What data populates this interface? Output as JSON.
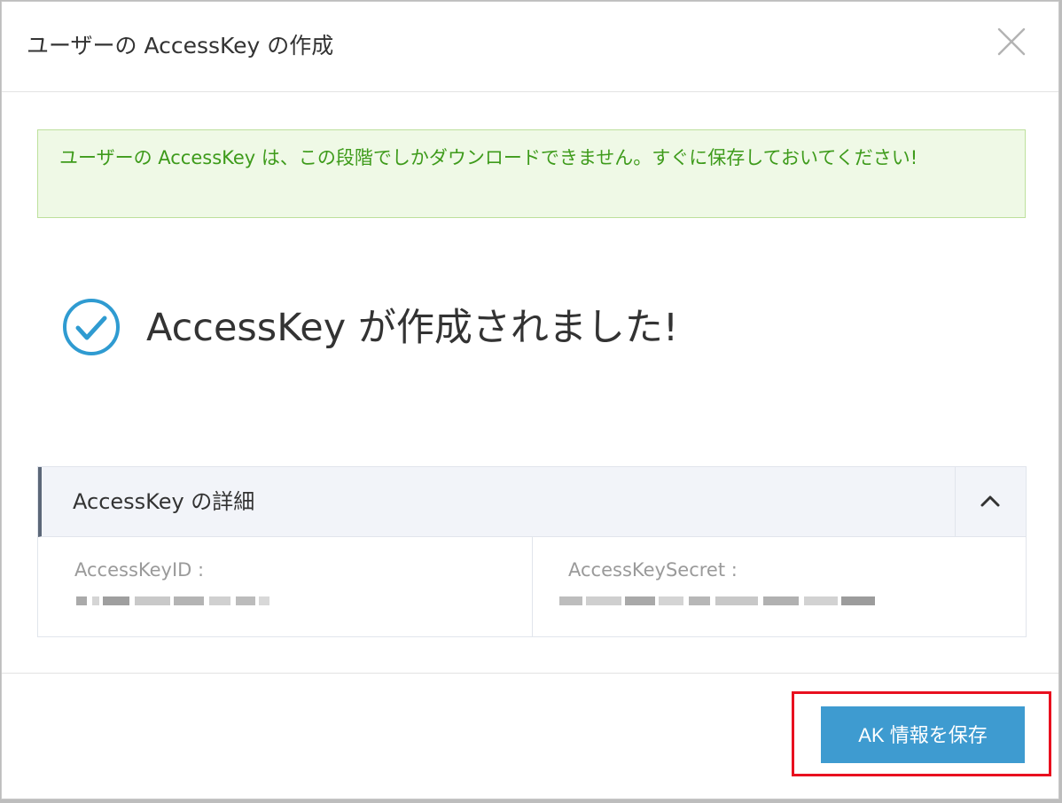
{
  "dialog": {
    "title": "ユーザーの AccessKey の作成",
    "close_icon": "close-icon"
  },
  "alert": {
    "message": "ユーザーの AccessKey は、この段階でしかダウンロードできません。すぐに保存しておいてください!"
  },
  "success": {
    "icon": "check-circle-icon",
    "message": "AccessKey が作成されました!"
  },
  "details": {
    "title": "AccessKey の詳細",
    "collapse_icon": "chevron-up-icon",
    "access_key_id_label": "AccessKeyID :",
    "access_key_secret_label": "AccessKeySecret :"
  },
  "footer": {
    "save_label": "AK 情報を保存"
  },
  "colors": {
    "primary_button": "#3e9bd0",
    "alert_text": "#3e9b1b",
    "alert_bg": "#eff9e6",
    "highlight": "#e8101f",
    "success_icon": "#2f9bd1"
  }
}
